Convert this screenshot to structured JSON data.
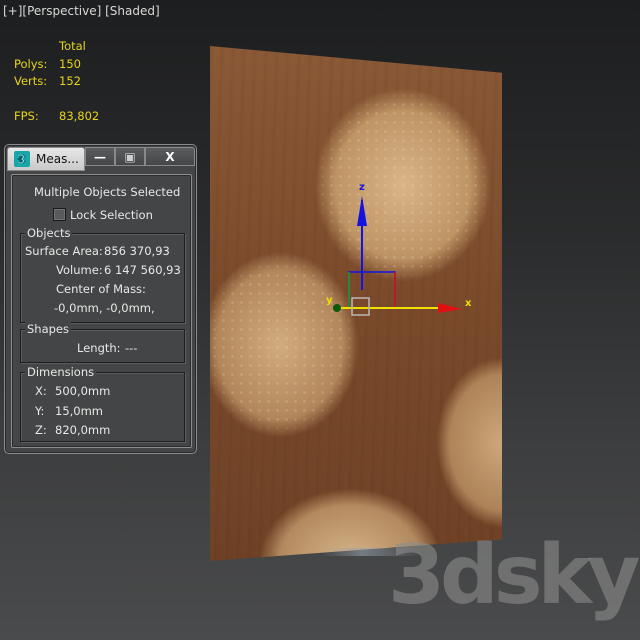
{
  "viewport": {
    "label_parts": [
      "[+]",
      "[Perspective]",
      "[Shaded]"
    ],
    "stats": {
      "header": "Total",
      "polys_label": "Polys:",
      "polys_value": "150",
      "verts_label": "Verts:",
      "verts_value": "152",
      "fps_label": "FPS:",
      "fps_value": "83,802"
    },
    "gizmo": {
      "x_label": "x",
      "y_label": "y",
      "z_label": "z",
      "colors": {
        "x": "#e01010",
        "y": "#0a7a0a",
        "z": "#1414e0",
        "highlight": "#f0e000"
      }
    },
    "watermark": "3dsky"
  },
  "dialog": {
    "title": "Meas...",
    "icon": "3dsmax-app-icon",
    "buttons": {
      "minimize": "—",
      "maximize": "▣",
      "close": "X"
    },
    "heading": "Multiple Objects Selected",
    "lock_selection": {
      "label": "Lock Selection",
      "checked": false
    },
    "objects": {
      "title": "Objects",
      "surface_area_label": "Surface Area:",
      "surface_area_value": "856 370,93",
      "volume_label": "Volume:",
      "volume_value": "6 147 560,93",
      "center_of_mass_label": "Center of Mass:",
      "center_of_mass_value": "-0,0mm, -0,0mm,"
    },
    "shapes": {
      "title": "Shapes",
      "length_label": "Length:",
      "length_value": "---"
    },
    "dimensions": {
      "title": "Dimensions",
      "x_label": "X:",
      "x_value": "500,0mm",
      "y_label": "Y:",
      "y_value": "15,0mm",
      "z_label": "Z:",
      "z_value": "820,0mm"
    }
  }
}
